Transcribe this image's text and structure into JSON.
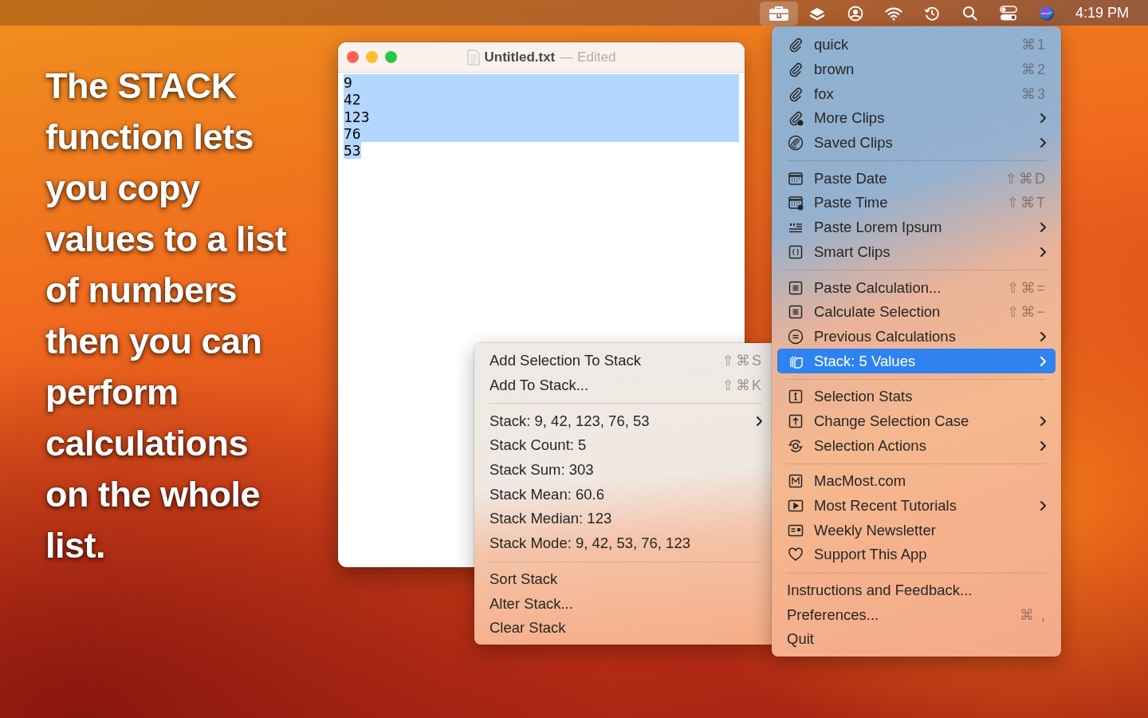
{
  "menu_bar": {
    "status_items": [
      {
        "selected": true
      },
      {
        "selected": false
      },
      {
        "selected": false
      },
      {
        "selected": false
      },
      {
        "selected": false
      },
      {
        "selected": false
      },
      {
        "selected": false
      },
      {
        "selected": false
      }
    ],
    "clock": "4:19 PM"
  },
  "caption": "The STACK function lets you copy values to a list of numbers then you can perform calculations on the whole list.",
  "editor_window": {
    "title": "Untitled.txt",
    "separator": "—",
    "status": "Edited",
    "lines": [
      {
        "text": "9",
        "selected": true
      },
      {
        "text": "42",
        "selected": true
      },
      {
        "text": "123",
        "selected": true
      },
      {
        "text": "76",
        "selected": true
      },
      {
        "text": "53",
        "selected": true
      }
    ]
  },
  "main_menu": {
    "sections": [
      {
        "items": [
          {
            "label": "quick",
            "shortcut": "⌘1",
            "submenu": false,
            "selected": false
          },
          {
            "label": "brown",
            "shortcut": "⌘2",
            "submenu": false,
            "selected": false
          },
          {
            "label": "fox",
            "shortcut": "⌘3",
            "submenu": false,
            "selected": false
          },
          {
            "label": "More Clips",
            "submenu": true,
            "selected": false
          },
          {
            "label": "Saved Clips",
            "submenu": true,
            "selected": false
          }
        ]
      },
      {
        "items": [
          {
            "label": "Paste Date",
            "shortcut": "⇧⌘D",
            "submenu": false,
            "selected": false
          },
          {
            "label": "Paste Time",
            "shortcut": "⇧⌘T",
            "submenu": false,
            "selected": false
          },
          {
            "label": "Paste Lorem Ipsum",
            "submenu": true,
            "selected": false
          },
          {
            "label": "Smart Clips",
            "submenu": true,
            "selected": false
          }
        ]
      },
      {
        "items": [
          {
            "label": "Paste Calculation...",
            "shortcut": "⇧⌘=",
            "submenu": false,
            "selected": false
          },
          {
            "label": "Calculate Selection",
            "shortcut": "⇧⌘−",
            "submenu": false,
            "selected": false
          },
          {
            "label": "Previous Calculations",
            "submenu": true,
            "selected": false
          },
          {
            "label": "Stack: 5 Values",
            "submenu": true,
            "selected": true
          }
        ]
      },
      {
        "items": [
          {
            "label": "Selection Stats",
            "submenu": false,
            "selected": false
          },
          {
            "label": "Change Selection Case",
            "submenu": true,
            "selected": false
          },
          {
            "label": "Selection Actions",
            "submenu": true,
            "selected": false
          }
        ]
      },
      {
        "items": [
          {
            "label": "MacMost.com",
            "submenu": false,
            "selected": false
          },
          {
            "label": "Most Recent Tutorials",
            "submenu": true,
            "selected": false
          },
          {
            "label": "Weekly Newsletter",
            "submenu": false,
            "selected": false
          },
          {
            "label": "Support This App",
            "submenu": false,
            "selected": false
          }
        ]
      },
      {
        "items": [
          {
            "label": "Instructions and Feedback...",
            "submenu": false,
            "selected": false
          },
          {
            "label": "Preferences...",
            "shortcut": "⌘ ,",
            "submenu": false,
            "selected": false
          },
          {
            "label": "Quit",
            "submenu": false,
            "selected": false
          }
        ]
      }
    ]
  },
  "stack_submenu": {
    "sections": [
      {
        "items": [
          {
            "label": "Add Selection To Stack",
            "shortcut": "⇧⌘S",
            "submenu": false,
            "selected": false
          },
          {
            "label": "Add To Stack...",
            "shortcut": "⇧⌘K",
            "submenu": false,
            "selected": false
          }
        ]
      },
      {
        "items": [
          {
            "label": "Stack: 9, 42, 123, 76, 53",
            "submenu": true,
            "selected": false
          },
          {
            "label": "Stack Count: 5",
            "submenu": false,
            "selected": false
          },
          {
            "label": "Stack Sum: 303",
            "submenu": false,
            "selected": false
          },
          {
            "label": "Stack Mean: 60.6",
            "submenu": false,
            "selected": false
          },
          {
            "label": "Stack Median: 123",
            "submenu": false,
            "selected": false
          },
          {
            "label": "Stack Mode: 9, 42, 53, 76, 123",
            "submenu": false,
            "selected": false
          }
        ]
      },
      {
        "items": [
          {
            "label": "Sort Stack",
            "submenu": false,
            "selected": false
          },
          {
            "label": "Alter Stack...",
            "submenu": false,
            "selected": false
          },
          {
            "label": "Clear Stack",
            "submenu": false,
            "selected": false
          }
        ]
      }
    ]
  }
}
